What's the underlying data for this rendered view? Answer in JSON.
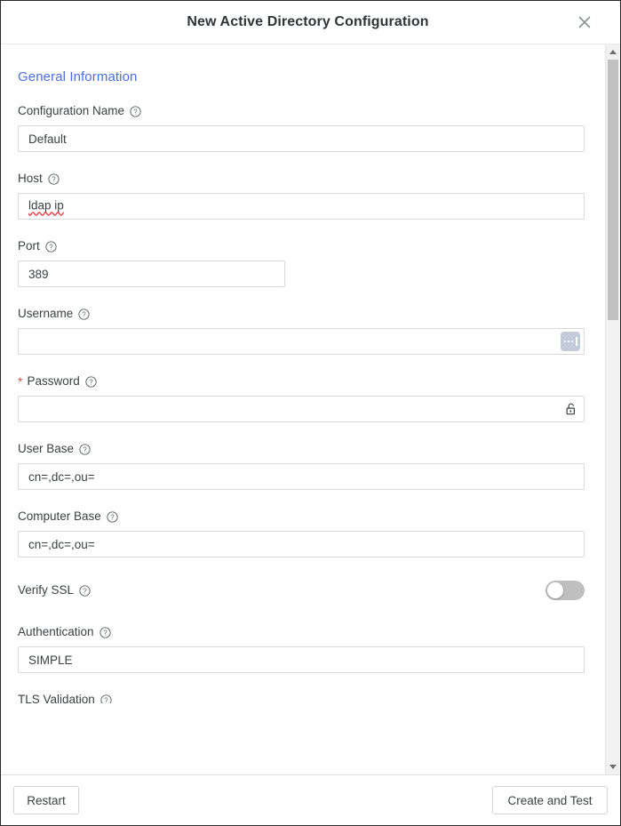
{
  "dialog": {
    "title": "New Active Directory Configuration",
    "close_icon": "close-icon",
    "section_title": "General Information"
  },
  "fields": [
    {
      "label": "Configuration Name",
      "value": "Default",
      "required": false,
      "help_icon": "help-circle-icon",
      "width": "full",
      "misspelled": false
    },
    {
      "label": "Host",
      "value": "ldap ip",
      "required": false,
      "help_icon": "help-circle-icon",
      "width": "full",
      "misspelled": true
    },
    {
      "label": "Port",
      "value": "389",
      "required": false,
      "help_icon": "help-circle-icon",
      "width": "narrow",
      "misspelled": false
    },
    {
      "label": "Username",
      "value": "",
      "required": false,
      "help_icon": "help-circle-icon",
      "width": "full",
      "misspelled": false,
      "trailing_icon": "autofill-icon"
    },
    {
      "label": "Password",
      "value": "",
      "required": true,
      "help_icon": "help-circle-icon",
      "width": "full",
      "misspelled": false,
      "trailing_icon": "unlock-icon"
    },
    {
      "label": "User Base",
      "value": "cn=,dc=,ou=",
      "required": false,
      "help_icon": "help-circle-icon",
      "width": "full",
      "misspelled": false
    },
    {
      "label": "Computer Base",
      "value": "cn=,dc=,ou=",
      "required": false,
      "help_icon": "help-circle-icon",
      "width": "full",
      "misspelled": false
    }
  ],
  "verify_ssl": {
    "label": "Verify SSL",
    "help_icon": "help-circle-icon",
    "enabled": false
  },
  "authentication": {
    "label": "Authentication",
    "help_icon": "help-circle-icon",
    "value": "SIMPLE"
  },
  "tls_validation": {
    "label": "TLS Validation",
    "help_icon": "help-circle-icon"
  },
  "scrollbar": {
    "up_icon": "scroll-up-arrow-icon",
    "down_icon": "scroll-down-arrow-icon"
  },
  "footer": {
    "restart_label": "Restart",
    "create_and_test_label": "Create and Test"
  },
  "colors": {
    "section_title": "#4a6fe3",
    "required_star": "#e04a4a",
    "text": "#3c4043",
    "border": "#d9d9d9",
    "toggle_off": "#bfbfbf",
    "autofill_chip": "#c4cbd8"
  }
}
